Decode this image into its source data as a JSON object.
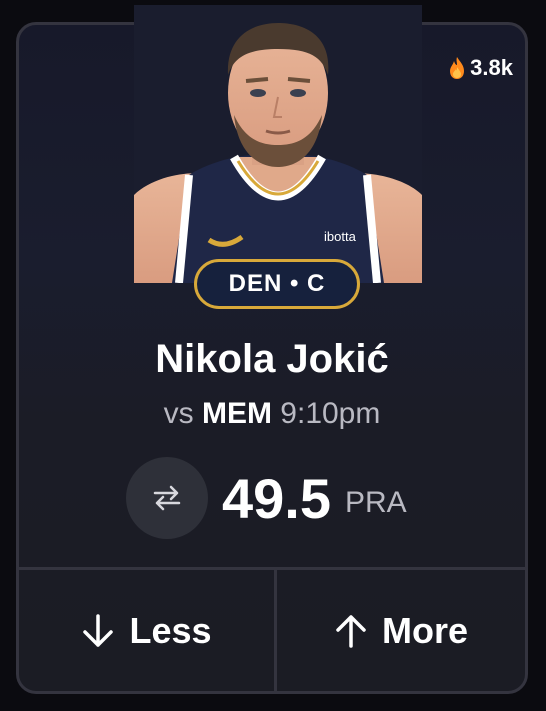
{
  "popularity": {
    "count": "3.8k",
    "icon": "flame-icon"
  },
  "player": {
    "name": "Nikola Jokić",
    "team_position": "DEN • C",
    "jersey_sponsor": "ibotta"
  },
  "game": {
    "prefix": "vs",
    "opponent": "MEM",
    "time": "9:10pm"
  },
  "projection": {
    "line": "49.5",
    "stat": "PRA"
  },
  "actions": {
    "less_label": "Less",
    "more_label": "More"
  },
  "colors": {
    "accent_gold": "#d8a93a",
    "pill_navy": "#16213d",
    "card_border": "#34343f"
  }
}
